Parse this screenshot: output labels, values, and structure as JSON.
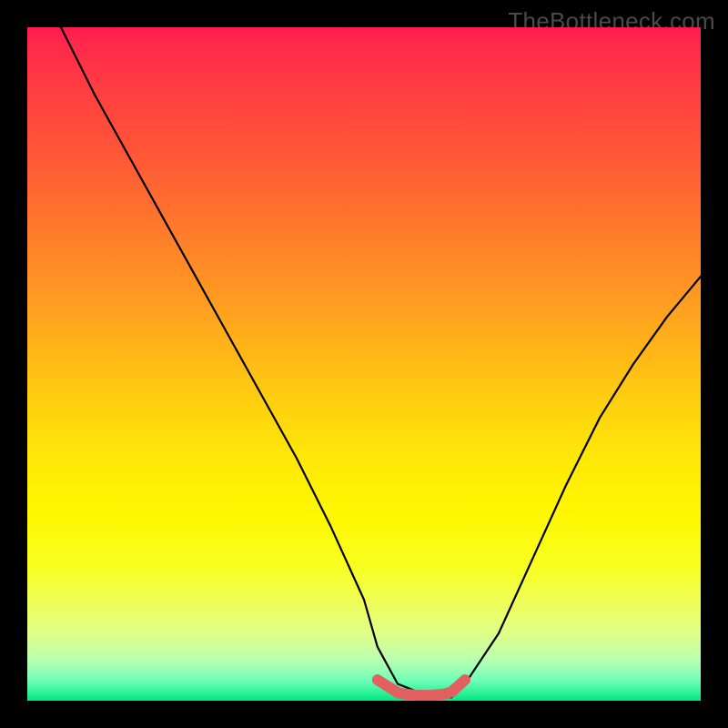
{
  "brand": {
    "text": "TheBottleneck.com"
  },
  "chart_data": {
    "type": "line",
    "title": "",
    "xlabel": "",
    "ylabel": "",
    "xlim": [
      0,
      100
    ],
    "ylim": [
      0,
      100
    ],
    "background_gradient": {
      "0": "#ff1a4d",
      "50": "#ffd010",
      "100": "#00e880"
    },
    "series": [
      {
        "name": "black-curve",
        "color": "#000000",
        "x": [
          5,
          10,
          15,
          20,
          25,
          30,
          35,
          40,
          45,
          50,
          52,
          55,
          60,
          63,
          65,
          70,
          75,
          80,
          85,
          90,
          95,
          100
        ],
        "values": [
          100,
          90,
          81,
          72,
          63,
          54,
          45,
          36,
          26,
          15,
          8,
          2.5,
          0.5,
          0.5,
          2.5,
          10,
          21,
          32,
          42,
          50,
          57,
          63
        ]
      },
      {
        "name": "red-marker-segment",
        "color": "#e26060",
        "x": [
          52,
          55,
          56,
          57,
          58,
          59,
          60,
          61,
          62,
          63,
          65
        ],
        "values": [
          3.1,
          1.2,
          1.0,
          0.9,
          0.8,
          0.8,
          0.8,
          0.9,
          1.0,
          1.3,
          3.1
        ]
      }
    ],
    "annotations": []
  }
}
